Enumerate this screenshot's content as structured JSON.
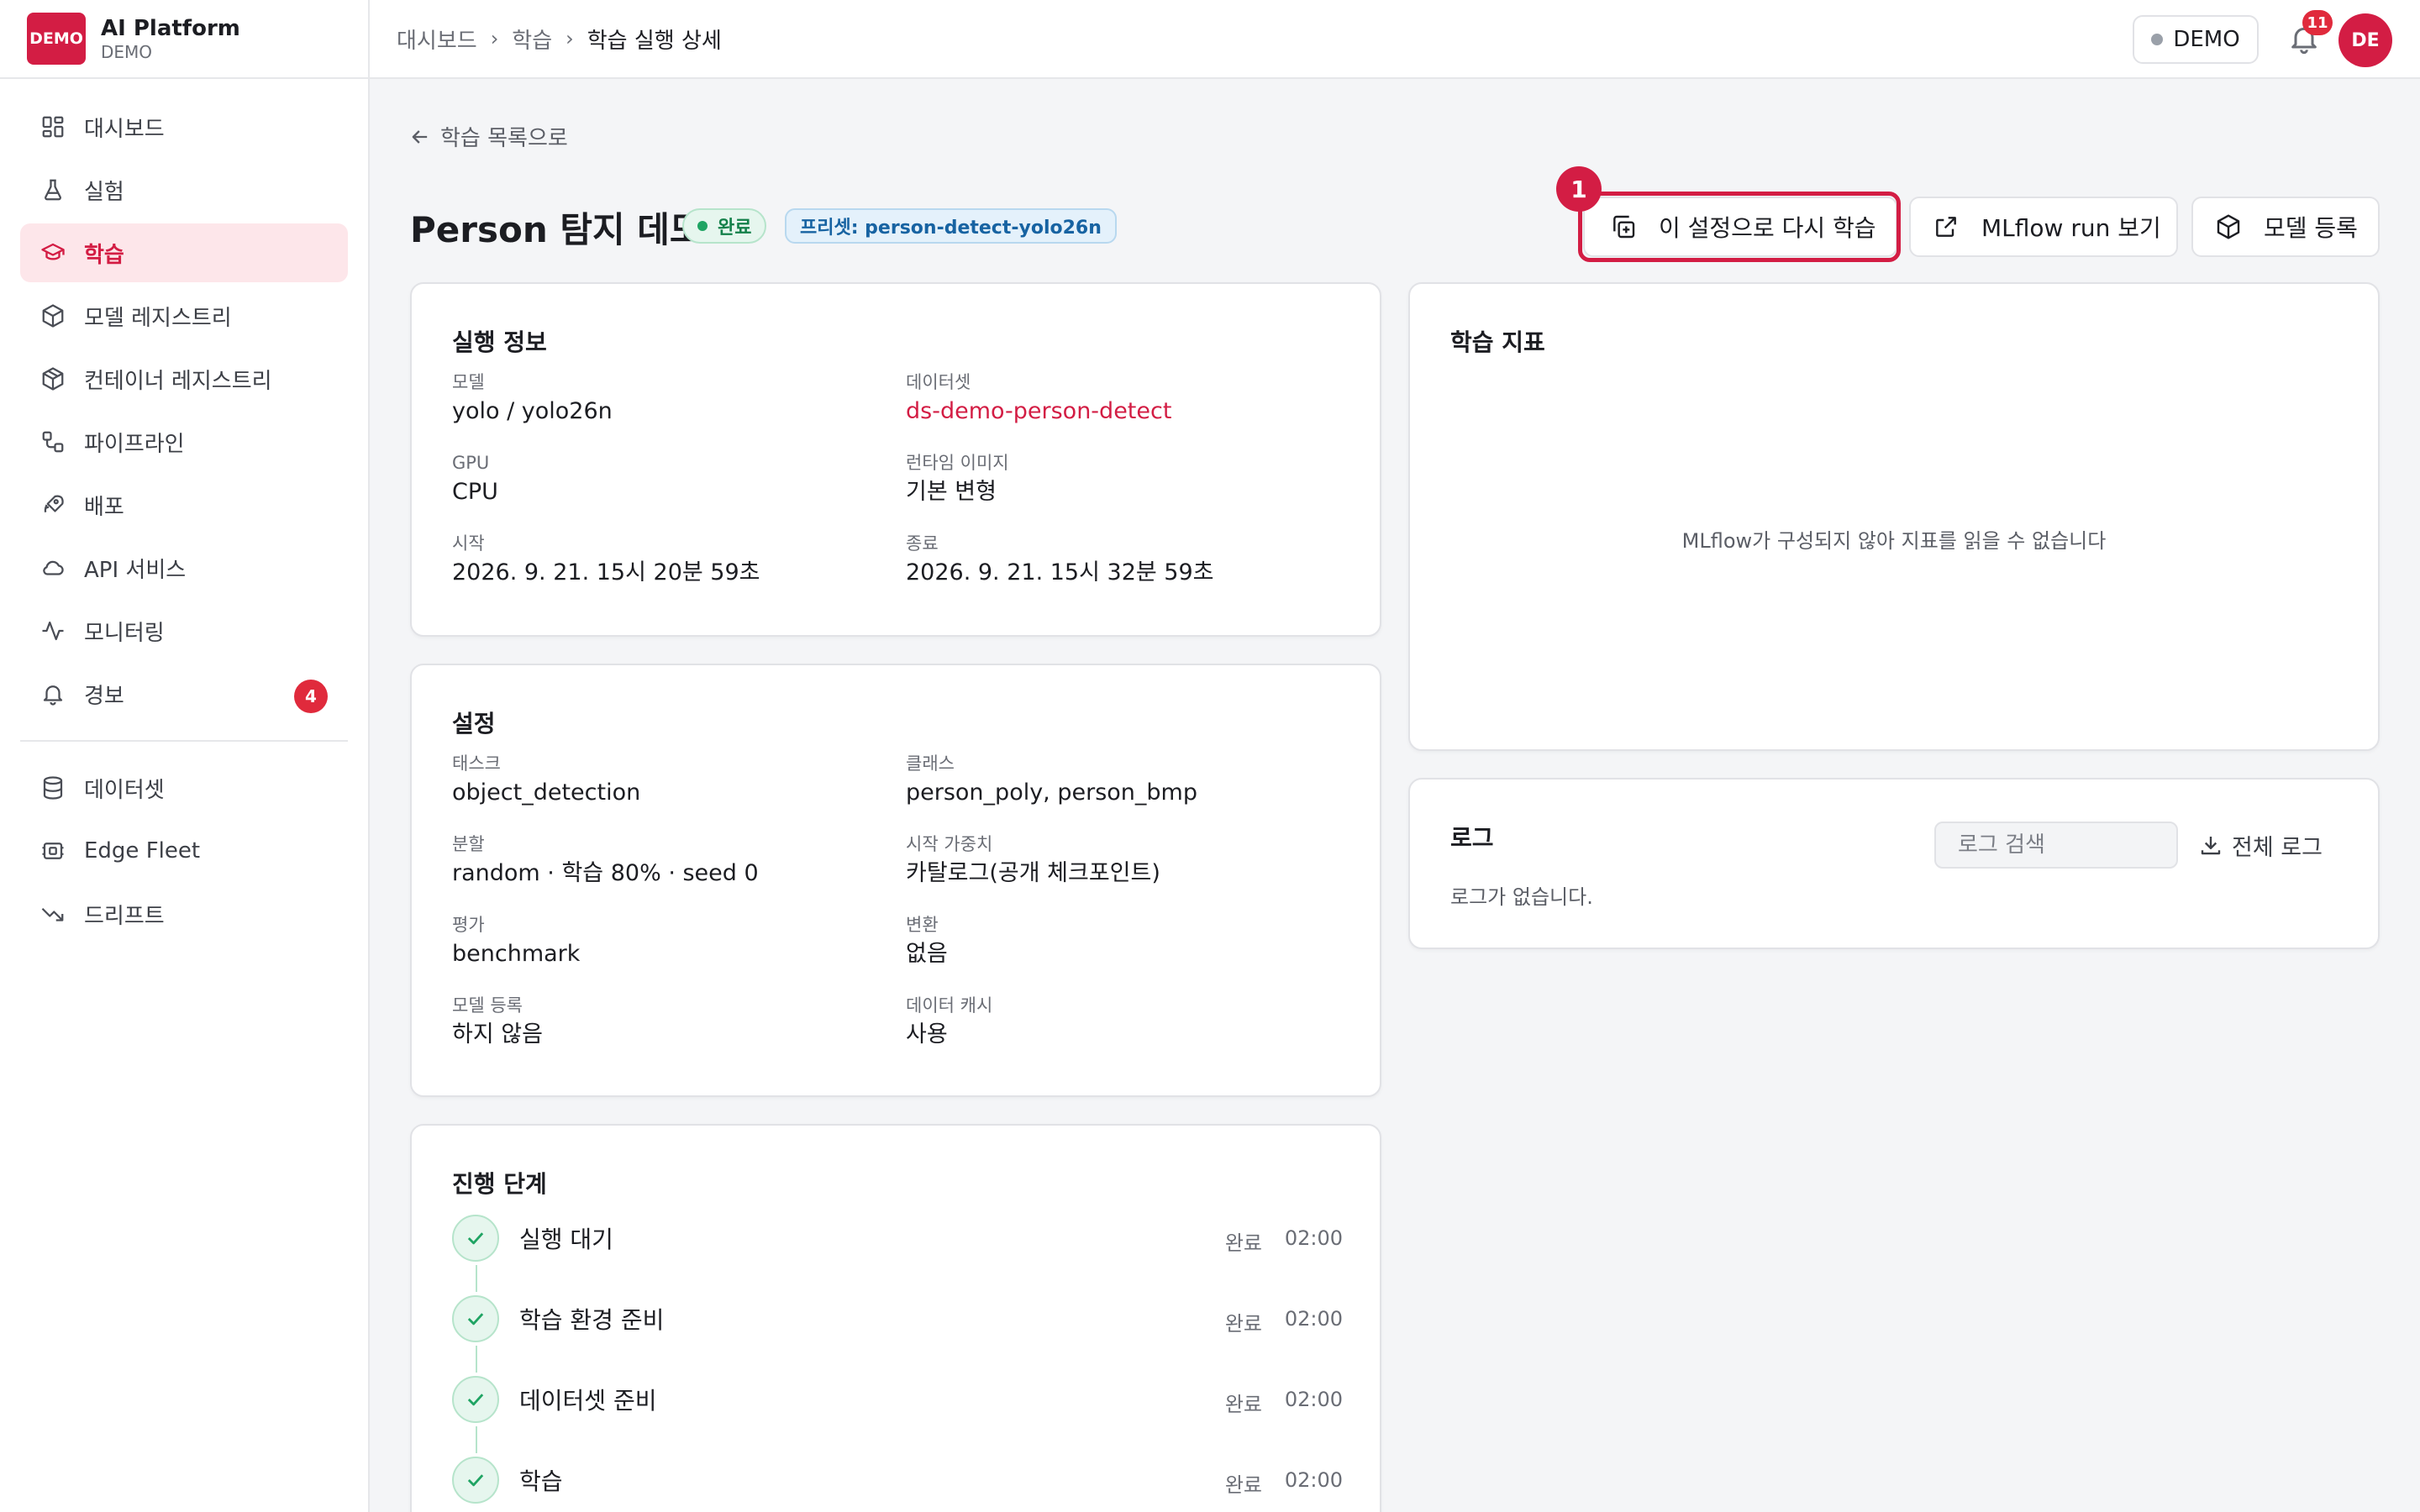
{
  "brand": {
    "logo_text": "DEMO",
    "title": "AI Platform",
    "subtitle": "DEMO"
  },
  "sidebar": {
    "items": [
      {
        "label": "대시보드",
        "icon": "dashboard-icon",
        "active": false
      },
      {
        "label": "실험",
        "icon": "flask-icon",
        "active": false
      },
      {
        "label": "학습",
        "icon": "graduation-cap-icon",
        "active": true
      },
      {
        "label": "모델 레지스트리",
        "icon": "cube-icon",
        "active": false
      },
      {
        "label": "컨테이너 레지스트리",
        "icon": "container-icon",
        "active": false
      },
      {
        "label": "파이프라인",
        "icon": "pipeline-icon",
        "active": false
      },
      {
        "label": "배포",
        "icon": "rocket-icon",
        "active": false
      },
      {
        "label": "API 서비스",
        "icon": "cloud-icon",
        "active": false
      },
      {
        "label": "모니터링",
        "icon": "activity-icon",
        "active": false
      },
      {
        "label": "경보",
        "icon": "bell-icon",
        "active": false,
        "badge": "4"
      }
    ],
    "secondary_items": [
      {
        "label": "데이터셋",
        "icon": "database-icon"
      },
      {
        "label": "Edge Fleet",
        "icon": "chip-icon"
      },
      {
        "label": "드리프트",
        "icon": "trending-down-icon"
      }
    ]
  },
  "topbar": {
    "breadcrumb": [
      "대시보드",
      "학습",
      "학습 실행 상세"
    ],
    "env_label": "DEMO",
    "notification_count": "11",
    "avatar_initials": "DE"
  },
  "page": {
    "back_label": "학습 목록으로",
    "title": "Person 탐지 데모",
    "status": "완료",
    "preset": "프리셋: person-detect-yolo26n",
    "actions": {
      "retrain": "이 설정으로 다시 학습",
      "mlflow": "MLflow run 보기",
      "register": "모델 등록"
    },
    "step_marker": "1"
  },
  "run_info": {
    "title": "실행 정보",
    "fields": [
      {
        "label": "모델",
        "value": "yolo / yolo26n"
      },
      {
        "label": "데이터셋",
        "value": "ds-demo-person-detect"
      },
      {
        "label": "GPU",
        "value": "CPU"
      },
      {
        "label": "런타임 이미지",
        "value": "기본 변형"
      },
      {
        "label": "시작",
        "value": "2026. 9. 21. 15시 20분 59초"
      },
      {
        "label": "종료",
        "value": "2026. 9. 21. 15시 32분 59초"
      }
    ]
  },
  "settings": {
    "title": "설정",
    "fields": [
      {
        "label": "태스크",
        "value": "object_detection"
      },
      {
        "label": "클래스",
        "value": "person_poly, person_bmp"
      },
      {
        "label": "분할",
        "value": "random · 학습 80% · seed 0"
      },
      {
        "label": "시작 가중치",
        "value": "카탈로그(공개 체크포인트)"
      },
      {
        "label": "평가",
        "value": "benchmark"
      },
      {
        "label": "변환",
        "value": "없음"
      },
      {
        "label": "모델 등록",
        "value": "하지 않음"
      },
      {
        "label": "데이터 캐시",
        "value": "사용"
      }
    ]
  },
  "metrics": {
    "title": "학습 지표",
    "empty_message": "MLflow가 구성되지 않아 지표를 읽을 수 없습니다"
  },
  "logs": {
    "title": "로그",
    "search_placeholder": "로그 검색",
    "full_label": "전체 로그",
    "empty_message": "로그가 없습니다."
  },
  "steps": {
    "title": "진행 단계",
    "items": [
      {
        "label": "실행 대기",
        "status": "완료",
        "time": "02:00"
      },
      {
        "label": "학습 환경 준비",
        "status": "완료",
        "time": "02:00"
      },
      {
        "label": "데이터셋 준비",
        "status": "완료",
        "time": "02:00"
      },
      {
        "label": "학습",
        "status": "완료",
        "time": "02:00"
      }
    ]
  },
  "colors": {
    "accent": "#d31d44",
    "success": "#1fa463",
    "info": "#1763a2",
    "danger_badge": "#e02a3c"
  }
}
